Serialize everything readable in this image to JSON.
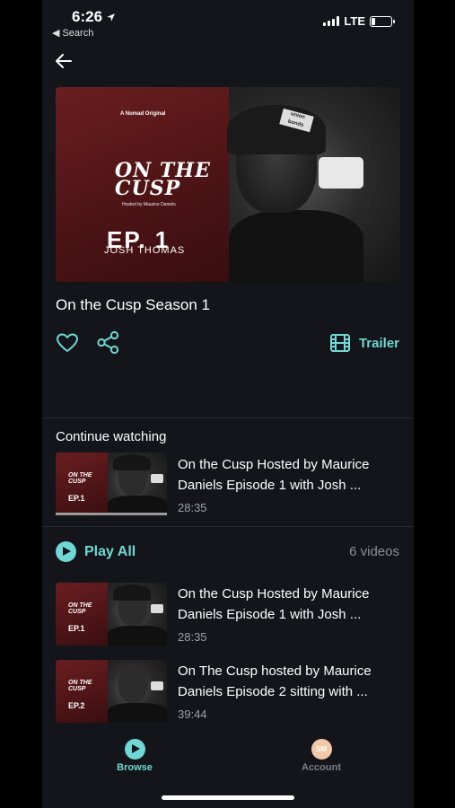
{
  "status_bar": {
    "time": "6:26",
    "back_app": "Search",
    "network": "LTE"
  },
  "hero": {
    "brand_line": "A Nomad Original",
    "show_logo_line1": "ON THE",
    "show_logo_line2": "CUSP",
    "hosted_line": "Hosted by Maurice Daniels",
    "episode_label": "EP. 1",
    "guest_name": "JOSH THOMAS",
    "cap_text": "union bonds"
  },
  "show": {
    "title": "On the Cusp Season 1",
    "trailer_label": "Trailer"
  },
  "continue_watching": {
    "title": "Continue watching",
    "item": {
      "title": "On the Cusp Hosted by Maurice Daniels Episode 1 with Josh ...",
      "duration": "28:35",
      "thumb_logo": "ON THE CUSP",
      "thumb_ep": "EP.1",
      "progress": 1.0
    }
  },
  "playlist": {
    "play_all_label": "Play All",
    "count_label": "6 videos",
    "items": [
      {
        "title": "On the Cusp Hosted by Maurice Daniels Episode 1 with Josh ...",
        "duration": "28:35",
        "thumb_logo": "ON THE CUSP",
        "thumb_ep": "EP.1"
      },
      {
        "title": "On The Cusp hosted by Maurice Daniels Episode 2 sitting with ...",
        "duration": "39:44",
        "thumb_logo": "ON THE CUSP",
        "thumb_ep": "EP.2"
      }
    ]
  },
  "tabs": [
    {
      "label": "Browse",
      "active": true
    },
    {
      "label": "Account",
      "initials": "SM",
      "active": false
    }
  ],
  "colors": {
    "accent": "#6fd8d4",
    "background": "#13151a",
    "muted": "#8a9097"
  }
}
